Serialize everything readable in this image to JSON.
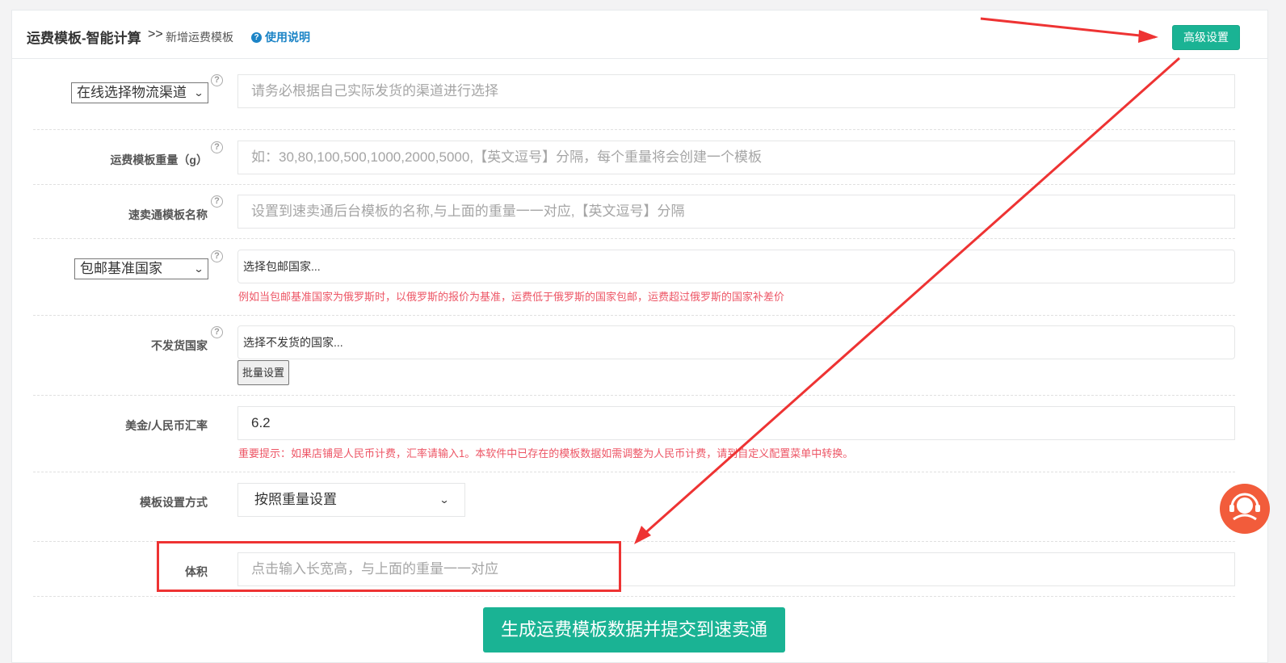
{
  "header": {
    "title": "运费模板-智能计算",
    "separator": ">>",
    "subtitle": "新增运费模板",
    "help_icon": "question-circle-icon",
    "help_label": "使用说明",
    "advanced_button": "高级设置"
  },
  "form": {
    "logistics_channel": {
      "select_label": "在线选择物流渠道",
      "placeholder": "请务必根据自己实际发货的渠道进行选择",
      "value": ""
    },
    "template_weight": {
      "label": "运费模板重量（g）",
      "placeholder": "如：30,80,100,500,1000,2000,5000,【英文逗号】分隔，每个重量将会创建一个模板",
      "value": ""
    },
    "template_name": {
      "label": "速卖通模板名称",
      "placeholder": "设置到速卖通后台模板的名称,与上面的重量一一对应,【英文逗号】分隔",
      "value": ""
    },
    "base_country": {
      "select_label": "包邮基准国家",
      "picker_text": "选择包邮国家...",
      "hint": "例如当包邮基准国家为俄罗斯时，以俄罗斯的报价为基准，运费低于俄罗斯的国家包邮，运费超过俄罗斯的国家补差价"
    },
    "no_ship_countries": {
      "label": "不发货国家",
      "picker_text": "选择不发货的国家...",
      "batch_button": "批量设置"
    },
    "exchange_rate": {
      "label": "美金/人民币汇率",
      "value": "6.2",
      "hint": "重要提示：如果店铺是人民币计费，汇率请输入1。本软件中已存在的模板数据如需调整为人民币计费，请到自定义配置菜单中转换。"
    },
    "template_mode": {
      "label": "模板设置方式",
      "selected": "按照重量设置"
    },
    "volume": {
      "label": "体积",
      "placeholder": "点击输入长宽高，与上面的重量一一对应",
      "value": ""
    },
    "submit_button": "生成运费模板数据并提交到速卖通"
  },
  "icons": {
    "help_tip": "?",
    "chat": "customer-service-icon"
  },
  "colors": {
    "primary": "#1ab394",
    "hint": "#ed5565",
    "annotation": "#ee3333",
    "link": "#1c84c6"
  }
}
